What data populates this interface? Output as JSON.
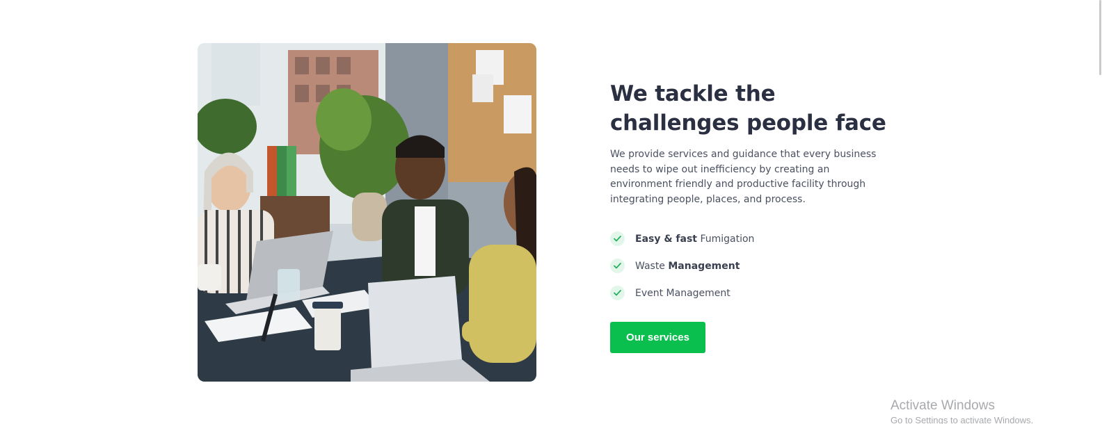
{
  "photo": {
    "alt": "Colleagues smiling while working together at an office table with laptops",
    "icon": "office-team-photo"
  },
  "headline": "We tackle the challenges people face",
  "description": "We provide services and guidance that every business needs to wipe out inefficiency by creating an environment friendly and productive facility through integrating people, places, and process.",
  "features": [
    {
      "bold": "Easy & fast",
      "rest": " Fumigation",
      "icon": "check-icon"
    },
    {
      "lead": "Waste ",
      "bold": "Management",
      "icon": "check-icon"
    },
    {
      "lead": "Event Management",
      "icon": "check-icon"
    }
  ],
  "cta": {
    "label": "Our services"
  },
  "watermark": {
    "title": "Activate Windows",
    "subtitle": "Go to Settings to activate Windows."
  },
  "colors": {
    "heading": "#2a3042",
    "body_text": "#4a5060",
    "accent_green": "#0bbf4f",
    "check_bg": "#e3f6ea",
    "check_mark": "#1fae5a"
  }
}
